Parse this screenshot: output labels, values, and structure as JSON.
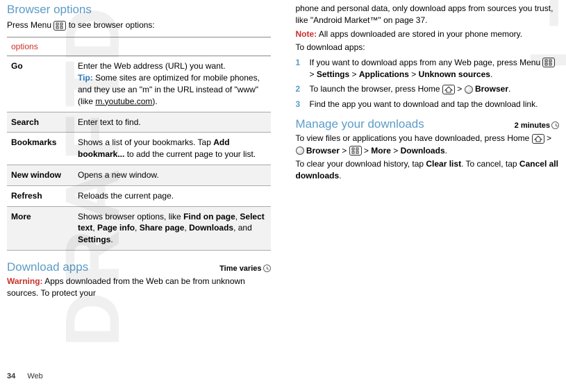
{
  "watermark": "DRAFT",
  "left": {
    "title1": "Browser options",
    "intro_a": "Press Menu ",
    "intro_b": " to see browser options:",
    "table_header": "options",
    "rows": [
      {
        "key": "Go",
        "body_a": "Enter the Web address (URL) you want.",
        "tip_label": "Tip:",
        "tip_body_a": " Some sites are optimized for mobile phones, and they use an \"m\" in the URL instead of \"www\" (like ",
        "tip_link": "m.youtube.com",
        "tip_body_b": ")."
      },
      {
        "key": "Search",
        "body": "Enter text to find."
      },
      {
        "key": "Bookmarks",
        "body_a": "Shows a list of your bookmarks. Tap ",
        "bold1": "Add bookmark...",
        "body_b": " to add the current page to your list."
      },
      {
        "key": "New window",
        "body": "Opens a new window."
      },
      {
        "key": "Refresh",
        "body": "Reloads the current page."
      },
      {
        "key": "More",
        "body_a": "Shows browser options, like ",
        "b1": "Find on page",
        "s1": ", ",
        "b2": "Select text",
        "s2": ", ",
        "b3": "Page info",
        "s3": ", ",
        "b4": "Share page",
        "s4": ", ",
        "b5": "Downloads",
        "s5": ", and ",
        "b6": "Settings",
        "s6": "."
      }
    ],
    "title2": "Download apps",
    "timer2": "Time varies",
    "warn_label": "Warning:",
    "warn_body": " Apps downloaded from the Web can be from unknown sources. To protect your"
  },
  "right": {
    "cont1": "phone and personal data, only download apps from sources you trust, like \"Android Market™\" on page 37.",
    "note_label": "Note:",
    "note_body": " All apps downloaded are stored in your phone memory.",
    "steps_intro": "To download apps:",
    "steps": [
      {
        "a": "If you want to download apps from any Web page, press Menu ",
        "b": " > ",
        "bold1": "Settings",
        "c": " > ",
        "bold2": "Applications",
        "d": " > ",
        "bold3": "Unknown sources",
        "e": "."
      },
      {
        "a": "To launch the browser, press Home ",
        "b": " > ",
        "bold1": "Browser",
        "c": "."
      },
      {
        "a": "Find the app you want to download and tap the download link."
      }
    ],
    "title3": "Manage your downloads",
    "timer3": "2 minutes",
    "para3_a": "To view files or applications you have downloaded, press Home ",
    "para3_b": " > ",
    "para3_bold1": "Browser",
    "para3_c": " > ",
    "para3_d": " > ",
    "para3_bold2": "More",
    "para3_e": " > ",
    "para3_bold3": "Downloads",
    "para3_f": ".",
    "para4_a": "To clear your download history, tap ",
    "para4_bold1": "Clear list",
    "para4_b": ". To cancel, tap ",
    "para4_bold2": "Cancel all downloads",
    "para4_c": "."
  },
  "footer": {
    "page": "34",
    "section": "Web"
  }
}
